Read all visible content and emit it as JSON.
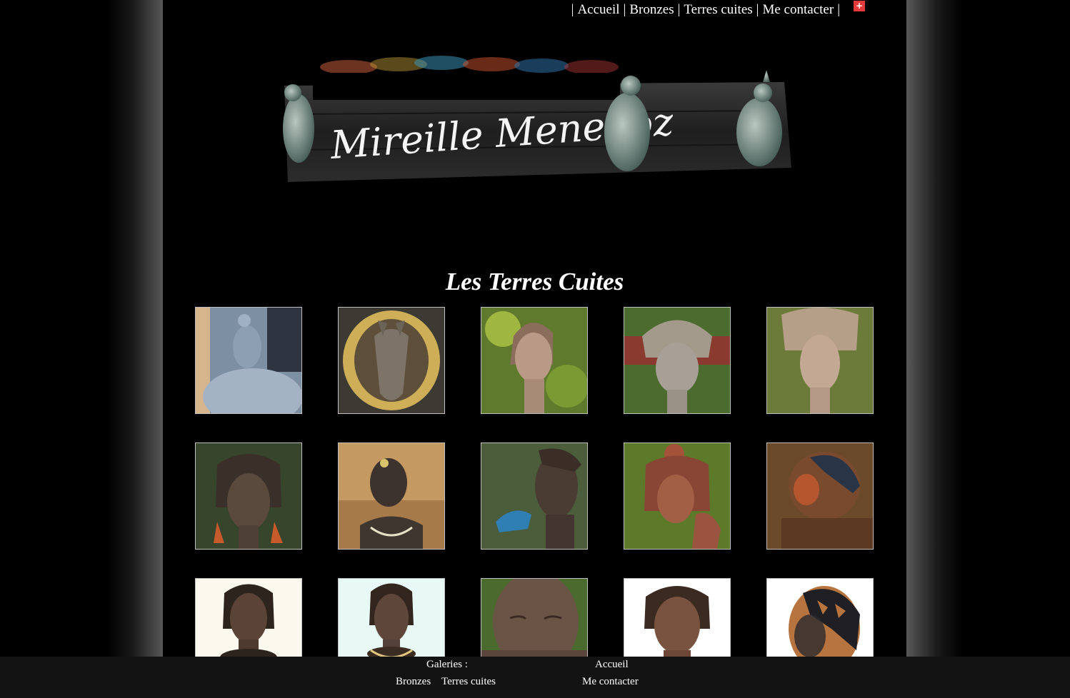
{
  "nav": {
    "items": [
      {
        "label": "Accueil"
      },
      {
        "label": "Bronzes"
      },
      {
        "label": "Terres cuites"
      },
      {
        "label": "Me contacter"
      }
    ],
    "flag": "+"
  },
  "banner": {
    "signature": "Mireille Menegoz"
  },
  "page_title": "Les Terres Cuites",
  "gallery": {
    "thumbnails": [
      {
        "subject": "sculpture-figure-on-elephant"
      },
      {
        "subject": "sculpture-animal-head-in-gold-frame"
      },
      {
        "subject": "sculpture-bust-bob-hair"
      },
      {
        "subject": "sculpture-bust-beaded-headdress"
      },
      {
        "subject": "sculpture-bust-braided-crown"
      },
      {
        "subject": "sculpture-bust-braids-earrings"
      },
      {
        "subject": "sculpture-bust-headband"
      },
      {
        "subject": "sculpture-profile-with-blue-bird"
      },
      {
        "subject": "sculpture-bust-locks-hand-on-cheek"
      },
      {
        "subject": "sculpture-head-profile-painted"
      },
      {
        "subject": "sculpture-bust-braids-necklace"
      },
      {
        "subject": "sculpture-bust-braids-necklace-2"
      },
      {
        "subject": "sculpture-face-closed-eyes"
      },
      {
        "subject": "sculpture-bust-cornrows"
      },
      {
        "subject": "sculpture-head-tattoo-pattern"
      }
    ]
  },
  "footer": {
    "galleries_label": "Galeries :",
    "bronzes": "Bronzes",
    "terres_cuites": "Terres cuites",
    "accueil": "Accueil",
    "contact": "Me contacter"
  }
}
